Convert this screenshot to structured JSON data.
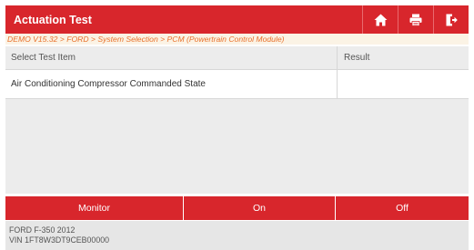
{
  "header": {
    "title": "Actuation Test",
    "home_icon": "home-icon",
    "print_icon": "print-icon",
    "exit_icon": "exit-icon"
  },
  "breadcrumb": "DEMO V15.32 > FORD > System Selection > PCM (Powertrain Control Module)",
  "table": {
    "columns": [
      "Select Test Item",
      "Result"
    ],
    "rows": [
      {
        "item": "Air Conditioning Compressor Commanded State",
        "result": ""
      }
    ]
  },
  "actions": {
    "monitor": "Monitor",
    "on": "On",
    "off": "Off"
  },
  "footer": {
    "vehicle": "FORD F-350 2012",
    "vin": "VIN 1FT8W3DT9CEB00000"
  },
  "colors": {
    "brand_red": "#d8262c",
    "breadcrumb_text": "#e8712c",
    "breadcrumb_bg": "#fbf3e5"
  }
}
